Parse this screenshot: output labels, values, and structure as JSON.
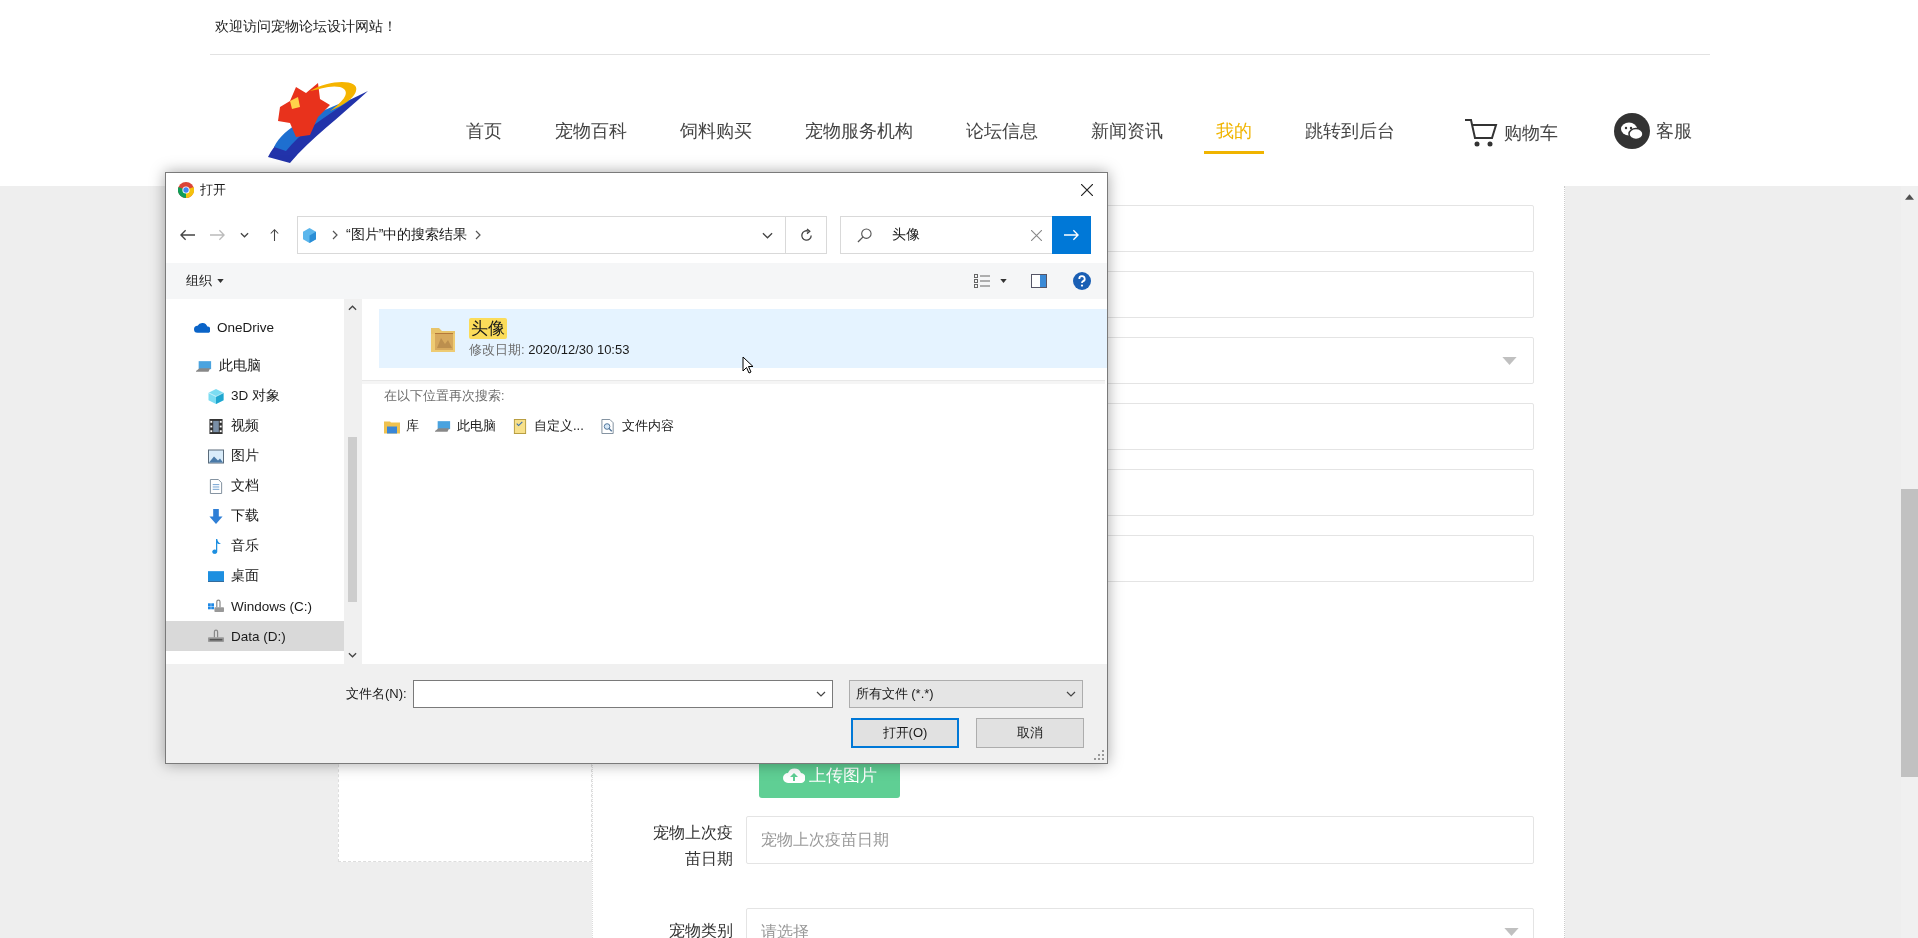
{
  "top_bar": {
    "welcome": "欢迎访问宠物论坛设计网站！"
  },
  "nav": {
    "items": [
      {
        "label": "首页",
        "selected": false
      },
      {
        "label": "宠物百科",
        "selected": false
      },
      {
        "label": "饲料购买",
        "selected": false
      },
      {
        "label": "宠物服务机构",
        "selected": false
      },
      {
        "label": "论坛信息",
        "selected": false
      },
      {
        "label": "新闻资讯",
        "selected": false
      },
      {
        "label": "我的",
        "selected": true
      },
      {
        "label": "跳转到后台",
        "selected": false
      }
    ],
    "cart": "购物车",
    "service": "客服"
  },
  "form": {
    "fields": [
      {
        "kind": "input"
      },
      {
        "kind": "input"
      },
      {
        "kind": "select"
      },
      {
        "kind": "input"
      },
      {
        "kind": "input"
      },
      {
        "kind": "input"
      }
    ],
    "upload_button": "上传图片",
    "rows": [
      {
        "label": "宠物上次疫苗日期",
        "kind": "input",
        "placeholder": "宠物上次疫苗日期"
      },
      {
        "label": "宠物类别",
        "kind": "select",
        "placeholder": "请选择"
      }
    ]
  },
  "dialog": {
    "title": "打开",
    "breadcrumb": "“图片”中的搜索结果",
    "search_value": "头像",
    "organize": "组织",
    "nav_pane": [
      {
        "label": "OneDrive",
        "kind": "cloud",
        "selected": false
      },
      {
        "label": "此电脑",
        "kind": "pc",
        "selected": false,
        "children": [
          {
            "label": "3D 对象",
            "kind": "cube",
            "selected": false
          },
          {
            "label": "视频",
            "kind": "film",
            "selected": false
          },
          {
            "label": "图片",
            "kind": "image",
            "selected": false
          },
          {
            "label": "文档",
            "kind": "document",
            "selected": false
          },
          {
            "label": "下载",
            "kind": "download",
            "selected": false
          },
          {
            "label": "音乐",
            "kind": "music",
            "selected": false
          },
          {
            "label": "桌面",
            "kind": "desktop",
            "selected": false
          },
          {
            "label": "Windows (C:)",
            "kind": "system-drive",
            "selected": false
          },
          {
            "label": "Data (D:)",
            "kind": "drive",
            "selected": true
          }
        ]
      }
    ],
    "results": [
      {
        "name": "头像",
        "date_label": "修改日期:",
        "date": "2020/12/30 10:53",
        "selected": true
      }
    ],
    "search_again": "在以下位置再次搜索:",
    "search_again_options": [
      {
        "label": "库",
        "kind": "library"
      },
      {
        "label": "此电脑",
        "kind": "pc"
      },
      {
        "label": "自定义...",
        "kind": "custom"
      },
      {
        "label": "文件内容",
        "kind": "file-content"
      }
    ],
    "filename_label": "文件名(N):",
    "filetype": "所有文件 (*.*)",
    "buttons": [
      {
        "label": "打开(O)",
        "kind": "primary"
      },
      {
        "label": "取消",
        "kind": "normal"
      }
    ]
  }
}
